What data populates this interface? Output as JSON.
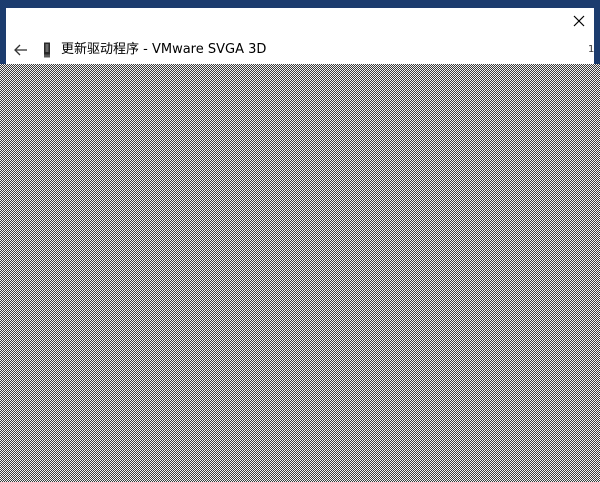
{
  "dialog": {
    "title": "更新驱动程序 - VMware SVGA 3D",
    "back_icon": "back-arrow-icon",
    "device_icon": "display-adapter-icon",
    "close_icon": "close-icon",
    "edge_glyph": "1"
  },
  "colors": {
    "window_frame": "#1c3c6e",
    "dialog_background": "#ffffff",
    "desktop_pattern_dark": "#3a3a3a",
    "desktop_pattern_light": "#f2f2f2",
    "text": "#000000"
  }
}
